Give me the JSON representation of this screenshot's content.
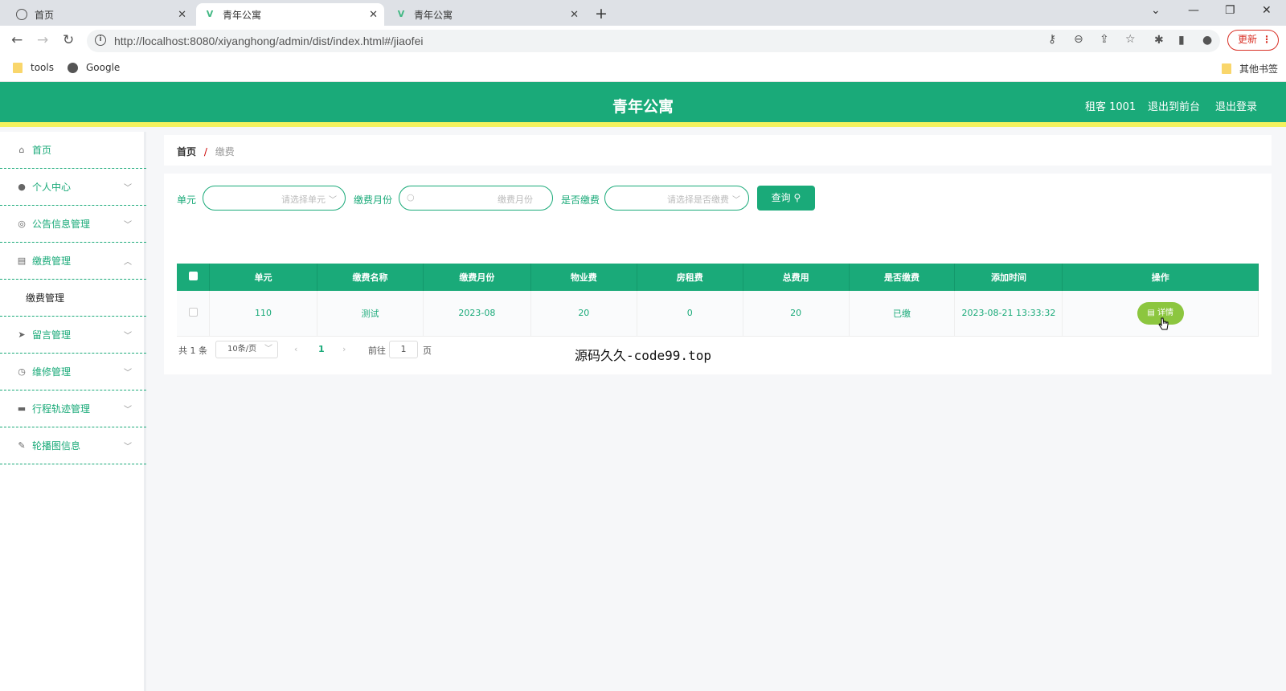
{
  "browser": {
    "tabs": [
      {
        "title": "首页",
        "active": false
      },
      {
        "title": "青年公寓",
        "active": true
      },
      {
        "title": "青年公寓",
        "active": false
      }
    ],
    "url": "http://localhost:8080/xiyanghong/admin/dist/index.html#/jiaofei",
    "update_label": "更新",
    "bookmarks": [
      {
        "label": "tools",
        "icon": "folder-icon"
      },
      {
        "label": "Google",
        "icon": "globe-icon"
      }
    ],
    "other_bookmarks": "其他书签"
  },
  "header": {
    "title": "青年公寓",
    "user": "租客 1001",
    "back_to_front": "退出到前台",
    "logout": "退出登录",
    "accent": "#1aaa79",
    "stripe": "#f3f25e"
  },
  "sidebar": {
    "items": [
      {
        "label": "首页",
        "icon": "home-icon"
      },
      {
        "label": "个人中心",
        "icon": "user-icon"
      },
      {
        "label": "公告信息管理",
        "icon": "notice-icon"
      },
      {
        "label": "缴费管理",
        "icon": "payment-icon"
      },
      {
        "label": "缴费管理",
        "icon": ""
      },
      {
        "label": "留言管理",
        "icon": "send-icon"
      },
      {
        "label": "维修管理",
        "icon": "repair-icon"
      },
      {
        "label": "行程轨迹管理",
        "icon": "track-icon"
      },
      {
        "label": "轮播图信息",
        "icon": "carousel-icon"
      }
    ]
  },
  "breadcrumb": {
    "home": "首页",
    "sep": "/",
    "current": "缴费"
  },
  "filters": {
    "unit_label": "单元",
    "unit_placeholder": "请选择单元",
    "month_label": "缴费月份",
    "month_placeholder": "缴费月份",
    "paid_label": "是否缴费",
    "paid_placeholder": "请选择是否缴费",
    "query_label": "查询"
  },
  "table": {
    "headers": [
      "单元",
      "缴费名称",
      "缴费月份",
      "物业费",
      "房租费",
      "总费用",
      "是否缴费",
      "添加时间",
      "操作"
    ],
    "rows": [
      {
        "unit": "110",
        "name": "测试",
        "month": "2023-08",
        "property_fee": "20",
        "rent": "0",
        "total": "20",
        "paid": "已缴",
        "added": "2023-08-21 13:33:32",
        "action": "详情"
      }
    ]
  },
  "pagination": {
    "total": "共 1 条",
    "page_size": "10条/页",
    "prev": "‹",
    "current": "1",
    "next": "›",
    "goto": "前往",
    "goto_value": "1",
    "page_unit": "页"
  },
  "watermark_caption": "源码久久-code99.top"
}
